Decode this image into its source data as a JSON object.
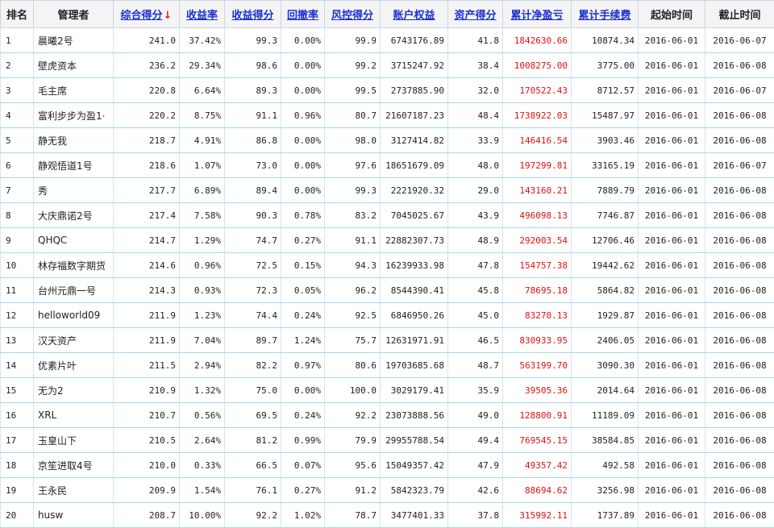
{
  "table": {
    "headers": {
      "rank": "排名",
      "manager": "管理者",
      "score": "综合得分",
      "return_rate": "收益率",
      "return_score": "收益得分",
      "drawdown": "回撤率",
      "risk_score": "风控得分",
      "equity": "账户权益",
      "asset_score": "资产得分",
      "net_pnl": "累计净盈亏",
      "fees": "累计手续费",
      "start_time": "起始时间",
      "end_time": "截止时间"
    },
    "sort_arrow": "↓",
    "rows": [
      {
        "rank": "1",
        "manager": "晨曦2号",
        "score": "241.0",
        "return_rate": "37.42%",
        "return_score": "99.3",
        "drawdown": "0.00%",
        "risk_score": "99.9",
        "equity": "6743176.89",
        "asset_score": "41.8",
        "net_pnl": "1842630.66",
        "fees": "10874.34",
        "start": "2016-06-01",
        "end": "2016-06-07"
      },
      {
        "rank": "2",
        "manager": "壁虎资本",
        "score": "236.2",
        "return_rate": "29.34%",
        "return_score": "98.6",
        "drawdown": "0.00%",
        "risk_score": "99.2",
        "equity": "3715247.92",
        "asset_score": "38.4",
        "net_pnl": "1008275.00",
        "fees": "3775.00",
        "start": "2016-06-01",
        "end": "2016-06-08"
      },
      {
        "rank": "3",
        "manager": "毛主席",
        "score": "220.8",
        "return_rate": "6.64%",
        "return_score": "89.3",
        "drawdown": "0.00%",
        "risk_score": "99.5",
        "equity": "2737885.90",
        "asset_score": "32.0",
        "net_pnl": "170522.43",
        "fees": "8712.57",
        "start": "2016-06-01",
        "end": "2016-06-07"
      },
      {
        "rank": "4",
        "manager": "富利步步为盈1·",
        "score": "220.2",
        "return_rate": "8.75%",
        "return_score": "91.1",
        "drawdown": "0.96%",
        "risk_score": "80.7",
        "equity": "21607187.23",
        "asset_score": "48.4",
        "net_pnl": "1738922.03",
        "fees": "15487.97",
        "start": "2016-06-01",
        "end": "2016-06-08"
      },
      {
        "rank": "5",
        "manager": "静无我",
        "score": "218.7",
        "return_rate": "4.91%",
        "return_score": "86.8",
        "drawdown": "0.00%",
        "risk_score": "98.0",
        "equity": "3127414.82",
        "asset_score": "33.9",
        "net_pnl": "146416.54",
        "fees": "3903.46",
        "start": "2016-06-01",
        "end": "2016-06-08"
      },
      {
        "rank": "6",
        "manager": "静观悟道1号",
        "score": "218.6",
        "return_rate": "1.07%",
        "return_score": "73.0",
        "drawdown": "0.00%",
        "risk_score": "97.6",
        "equity": "18651679.09",
        "asset_score": "48.0",
        "net_pnl": "197299.81",
        "fees": "33165.19",
        "start": "2016-06-01",
        "end": "2016-06-07"
      },
      {
        "rank": "7",
        "manager": "秀",
        "score": "217.7",
        "return_rate": "6.89%",
        "return_score": "89.4",
        "drawdown": "0.00%",
        "risk_score": "99.3",
        "equity": "2221920.32",
        "asset_score": "29.0",
        "net_pnl": "143160.21",
        "fees": "7889.79",
        "start": "2016-06-01",
        "end": "2016-06-08"
      },
      {
        "rank": "8",
        "manager": "大庆鼎诺2号",
        "score": "217.4",
        "return_rate": "7.58%",
        "return_score": "90.3",
        "drawdown": "0.78%",
        "risk_score": "83.2",
        "equity": "7045025.67",
        "asset_score": "43.9",
        "net_pnl": "496098.13",
        "fees": "7746.87",
        "start": "2016-06-01",
        "end": "2016-06-08"
      },
      {
        "rank": "9",
        "manager": "QHQC",
        "score": "214.7",
        "return_rate": "1.29%",
        "return_score": "74.7",
        "drawdown": "0.27%",
        "risk_score": "91.1",
        "equity": "22882307.73",
        "asset_score": "48.9",
        "net_pnl": "292003.54",
        "fees": "12706.46",
        "start": "2016-06-01",
        "end": "2016-06-08"
      },
      {
        "rank": "10",
        "manager": "林存福数字期货",
        "score": "214.6",
        "return_rate": "0.96%",
        "return_score": "72.5",
        "drawdown": "0.15%",
        "risk_score": "94.3",
        "equity": "16239933.98",
        "asset_score": "47.8",
        "net_pnl": "154757.38",
        "fees": "19442.62",
        "start": "2016-06-01",
        "end": "2016-06-08"
      },
      {
        "rank": "11",
        "manager": "台州元鼎一号",
        "score": "214.3",
        "return_rate": "0.93%",
        "return_score": "72.3",
        "drawdown": "0.05%",
        "risk_score": "96.2",
        "equity": "8544390.41",
        "asset_score": "45.8",
        "net_pnl": "78695.18",
        "fees": "5864.82",
        "start": "2016-06-01",
        "end": "2016-06-08"
      },
      {
        "rank": "12",
        "manager": "helloworld09",
        "score": "211.9",
        "return_rate": "1.23%",
        "return_score": "74.4",
        "drawdown": "0.24%",
        "risk_score": "92.5",
        "equity": "6846950.26",
        "asset_score": "45.0",
        "net_pnl": "83270.13",
        "fees": "1929.87",
        "start": "2016-06-01",
        "end": "2016-06-08"
      },
      {
        "rank": "13",
        "manager": "汉天资产",
        "score": "211.9",
        "return_rate": "7.04%",
        "return_score": "89.7",
        "drawdown": "1.24%",
        "risk_score": "75.7",
        "equity": "12631971.91",
        "asset_score": "46.5",
        "net_pnl": "830933.95",
        "fees": "2406.05",
        "start": "2016-06-01",
        "end": "2016-06-08"
      },
      {
        "rank": "14",
        "manager": "优素片叶",
        "score": "211.5",
        "return_rate": "2.94%",
        "return_score": "82.2",
        "drawdown": "0.97%",
        "risk_score": "80.6",
        "equity": "19703685.68",
        "asset_score": "48.7",
        "net_pnl": "563199.70",
        "fees": "3090.30",
        "start": "2016-06-01",
        "end": "2016-06-08"
      },
      {
        "rank": "15",
        "manager": "无为2",
        "score": "210.9",
        "return_rate": "1.32%",
        "return_score": "75.0",
        "drawdown": "0.00%",
        "risk_score": "100.0",
        "equity": "3029179.41",
        "asset_score": "35.9",
        "net_pnl": "39505.36",
        "fees": "2014.64",
        "start": "2016-06-01",
        "end": "2016-06-08"
      },
      {
        "rank": "16",
        "manager": "XRL",
        "score": "210.7",
        "return_rate": "0.56%",
        "return_score": "69.5",
        "drawdown": "0.24%",
        "risk_score": "92.2",
        "equity": "23073888.56",
        "asset_score": "49.0",
        "net_pnl": "128800.91",
        "fees": "11189.09",
        "start": "2016-06-01",
        "end": "2016-06-08"
      },
      {
        "rank": "17",
        "manager": "玉皇山下",
        "score": "210.5",
        "return_rate": "2.64%",
        "return_score": "81.2",
        "drawdown": "0.99%",
        "risk_score": "79.9",
        "equity": "29955788.54",
        "asset_score": "49.4",
        "net_pnl": "769545.15",
        "fees": "38584.85",
        "start": "2016-06-01",
        "end": "2016-06-08"
      },
      {
        "rank": "18",
        "manager": "京笙进取4号",
        "score": "210.0",
        "return_rate": "0.33%",
        "return_score": "66.5",
        "drawdown": "0.07%",
        "risk_score": "95.6",
        "equity": "15049357.42",
        "asset_score": "47.9",
        "net_pnl": "49357.42",
        "fees": "492.58",
        "start": "2016-06-01",
        "end": "2016-06-08"
      },
      {
        "rank": "19",
        "manager": "王永民",
        "score": "209.9",
        "return_rate": "1.54%",
        "return_score": "76.1",
        "drawdown": "0.27%",
        "risk_score": "91.2",
        "equity": "5842323.79",
        "asset_score": "42.6",
        "net_pnl": "88694.62",
        "fees": "3256.98",
        "start": "2016-06-01",
        "end": "2016-06-08"
      },
      {
        "rank": "20",
        "manager": "husw",
        "score": "208.7",
        "return_rate": "10.00%",
        "return_score": "92.2",
        "drawdown": "1.02%",
        "risk_score": "78.7",
        "equity": "3477401.33",
        "asset_score": "37.8",
        "net_pnl": "315992.11",
        "fees": "1737.89",
        "start": "2016-06-01",
        "end": "2016-06-08"
      }
    ]
  },
  "colors": {
    "link_blue": "#1c2fd1",
    "pnl_red": "#e01010",
    "row_border": "#a9d6ef",
    "header_bg": "#f4f4f4"
  },
  "icons": {
    "sort": "sort-desc-arrow-icon"
  }
}
